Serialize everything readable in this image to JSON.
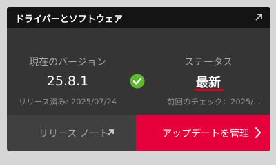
{
  "header": {
    "title": "ドライバーとソフトウェア",
    "expand_icon": "arrow-up-right-icon"
  },
  "current_version": {
    "label": "現在のバージョン",
    "value": "25.8.1",
    "release_date": "リリース済み: 2025/07/24"
  },
  "status_icon": "checkmark-circle-icon",
  "status": {
    "label": "ステータス",
    "value": "最新",
    "last_check": "前回のチェック：2025/..."
  },
  "buttons": {
    "release_notes_label": "リリース ノート",
    "release_notes_icon": "arrow-up-right-icon",
    "manage_updates_label": "アップデートを管理",
    "manage_updates_icon": "chevron-right-icon"
  },
  "colors": {
    "accent": "#e5003c",
    "status_ok": "#5fb832",
    "underline": "#d9001b"
  }
}
